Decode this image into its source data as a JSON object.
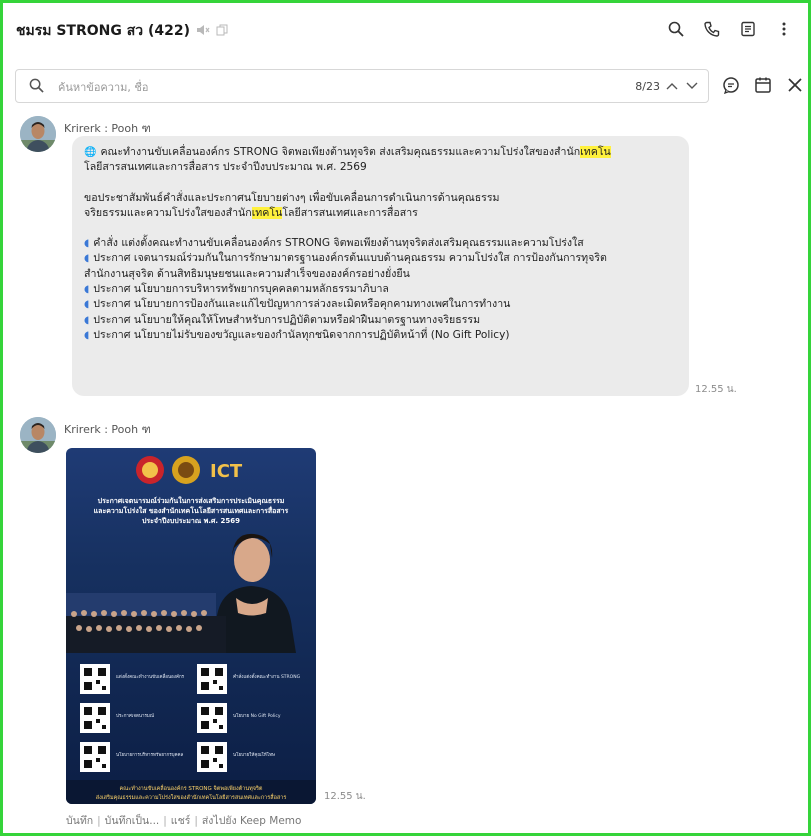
{
  "header": {
    "title": "ชมรม STRONG สว (422)",
    "icons": [
      "speaker-muted-icon",
      "copy-icon",
      "search-icon",
      "phone-icon",
      "notes-icon",
      "more-icon"
    ]
  },
  "search": {
    "placeholder": "ค้นหาข้อความ, ชื่อ",
    "count": "8/23"
  },
  "messages": [
    {
      "sender": "Krirerk : Pooh ฑ",
      "time": "12.55 น.",
      "lines": {
        "l1a": "คณะทำงานขับเคลื่อนองค์กร STRONG จิตพอเพียงต้านทุจริต ส่งเสริมคุณธรรมและความโปร่งใสของสำนัก",
        "hl1": "เทคโน",
        "l2": "โลยีสารสนเทศและการสื่อสาร ประจำปีงบประมาณ พ.ศ. 2569",
        "l3": "ขอประชาสัมพันธ์คำสั่งและประกาศนโยบายต่างๆ เพื่อขับเคลื่อนการดำเนินการด้านคุณธรรม",
        "l4a": "จริยธรรมและความโปร่งใสของสำนัก",
        "hl2": "เทคโน",
        "l4b": "โลยีสารสนเทศและการสื่อสาร",
        "b1": "คำสั่ง แต่งตั้งคณะทำงานขับเคลื่อนองค์กร STRONG จิตพอเพียงต้านทุจริตส่งเสริมคุณธรรมและความโปร่งใส",
        "b2a": "ประกาศ เจตนารมณ์ร่วมกันในการรักษามาตรฐานองค์กรต้นแบบด้านคุณธรรม ความโปร่งใส การป้องกันการทุจริต",
        "b2b": "สำนักงานสุจริต ด้านสิทธิมนุษยชนและความสำเร็จขององค์กรอย่างยั่งยืน",
        "b3": "ประกาศ นโยบายการบริหารทรัพยากรบุคคลตามหลักธรรมาภิบาล",
        "b4": "ประกาศ นโยบายการป้องกันและแก้ไขปัญหาการล่วงละเมิดหรือคุกคามทางเพศในการทำงาน",
        "b5": "ประกาศ นโยบายให้คุณให้โทษสำหรับการปฏิบัติตามหรือฝ่าฝืนมาตรฐานทางจริยธรรม",
        "b6": "ประกาศ นโยบายไม่รับของขวัญและของกำนัลทุกชนิดจากการปฏิบัติหน้าที่ (No Gift Policy)"
      }
    },
    {
      "sender": "Krirerk : Pooh ฑ",
      "time": "12.55 น.",
      "poster": {
        "logo_text": "ICT",
        "heading1": "ประกาศเจตนารมณ์ร่วมกันในการส่งเสริมการประเมินคุณธรรม",
        "heading2": "และความโปร่งใส ของสำนักเทคโนโลยีสารสนเทศและการสื่อสาร",
        "heading3": "ประจำปีงบประมาณ พ.ศ. 2569",
        "qr_left": [
          "แต่งตั้งคณะทำงานขับเคลื่อนองค์กร",
          "ประกาศเจตนารมณ์",
          "นโยบายการบริหารทรัพยากรบุคคล"
        ],
        "qr_right": [
          "คำสั่งแต่งตั้งคณะทำงาน STRONG",
          "นโยบาย No Gift Policy",
          "นโยบายให้คุณให้โทษ"
        ],
        "footer1": "คณะทำงานขับเคลื่อนองค์กร STRONG จิตพอเพียงต้านทุจริต",
        "footer2": "ส่งเสริมคุณธรรมและความโปร่งใสของสำนักเทคโนโลยีสารสนเทศและการสื่อสาร"
      },
      "actions": [
        "บันทึก",
        "บันทึกเป็น...",
        "แชร์",
        "ส่งไปยัง Keep Memo"
      ]
    }
  ]
}
